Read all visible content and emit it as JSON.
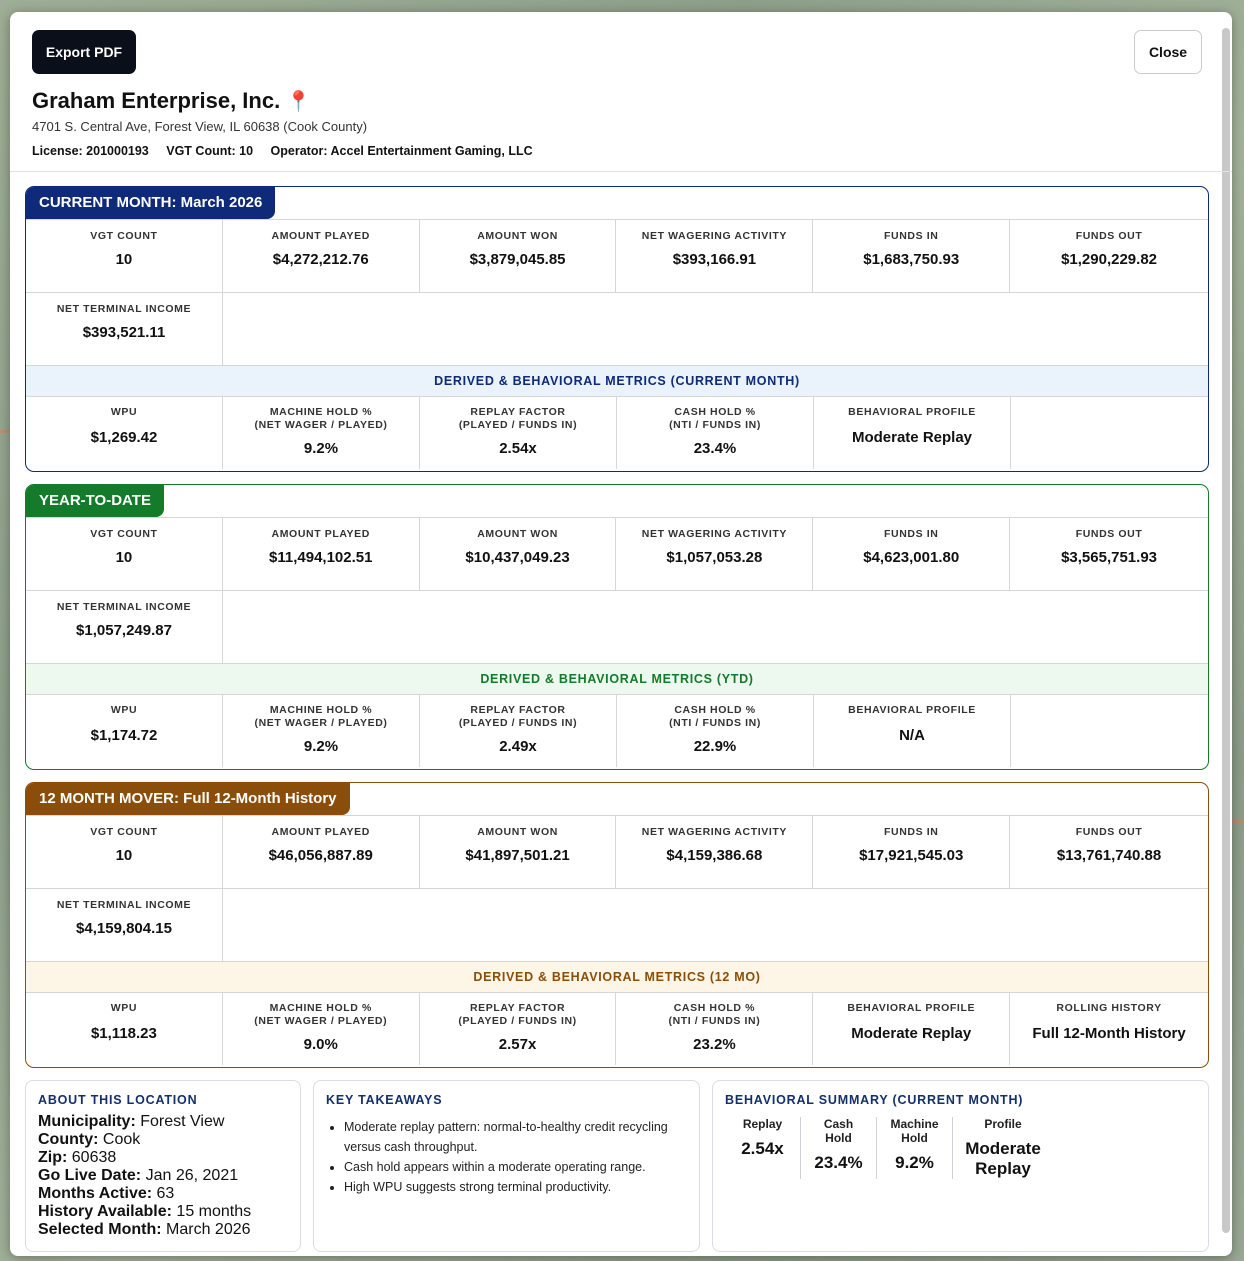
{
  "header": {
    "export_label": "Export PDF",
    "close_label": "Close",
    "title": "Graham Enterprise, Inc.",
    "pin_glyph": "📍",
    "address": "4701 S. Central Ave, Forest View, IL 60638 (Cook County)",
    "license": "License: 201000193",
    "vgt_count": "VGT Count: 10",
    "operator": "Operator: Accel Entertainment Gaming, LLC"
  },
  "colors": {
    "current": "#0e2a78",
    "ytd": "#137b2a",
    "mover": "#8a4e0a",
    "current_sub_bg": "#eaf3fc",
    "ytd_sub_bg": "#edf8ee",
    "mover_sub_bg": "#fdf6e6"
  },
  "current": {
    "tag": "CURRENT MONTH: March 2026",
    "labels": [
      "VGT COUNT",
      "AMOUNT PLAYED",
      "AMOUNT WON",
      "NET WAGERING ACTIVITY",
      "FUNDS IN",
      "FUNDS OUT"
    ],
    "values": [
      "10",
      "$4,272,212.76",
      "$3,879,045.85",
      "$393,166.91",
      "$1,683,750.93",
      "$1,290,229.82"
    ],
    "nti_label": "NET TERMINAL INCOME",
    "nti_value": "$393,521.11",
    "sub": "DERIVED & BEHAVIORAL METRICS (CURRENT MONTH)",
    "derived": [
      {
        "l1": "WPU",
        "l2": "",
        "v": "$1,269.42"
      },
      {
        "l1": "MACHINE HOLD %",
        "l2": "(NET WAGER / PLAYED)",
        "v": "9.2%"
      },
      {
        "l1": "REPLAY FACTOR",
        "l2": "(PLAYED / FUNDS IN)",
        "v": "2.54x"
      },
      {
        "l1": "CASH HOLD %",
        "l2": "(NTI / FUNDS IN)",
        "v": "23.4%"
      },
      {
        "l1": "BEHAVIORAL PROFILE",
        "l2": "",
        "v": "Moderate Replay"
      }
    ]
  },
  "ytd": {
    "tag": "YEAR-TO-DATE",
    "labels": [
      "VGT COUNT",
      "AMOUNT PLAYED",
      "AMOUNT WON",
      "NET WAGERING ACTIVITY",
      "FUNDS IN",
      "FUNDS OUT"
    ],
    "values": [
      "10",
      "$11,494,102.51",
      "$10,437,049.23",
      "$1,057,053.28",
      "$4,623,001.80",
      "$3,565,751.93"
    ],
    "nti_label": "NET TERMINAL INCOME",
    "nti_value": "$1,057,249.87",
    "sub": "DERIVED & BEHAVIORAL METRICS (YTD)",
    "derived": [
      {
        "l1": "WPU",
        "l2": "",
        "v": "$1,174.72"
      },
      {
        "l1": "MACHINE HOLD %",
        "l2": "(NET WAGER / PLAYED)",
        "v": "9.2%"
      },
      {
        "l1": "REPLAY FACTOR",
        "l2": "(PLAYED / FUNDS IN)",
        "v": "2.49x"
      },
      {
        "l1": "CASH HOLD %",
        "l2": "(NTI / FUNDS IN)",
        "v": "22.9%"
      },
      {
        "l1": "BEHAVIORAL PROFILE",
        "l2": "",
        "v": "N/A"
      }
    ]
  },
  "mover": {
    "tag": "12 MONTH MOVER: Full 12-Month History",
    "labels": [
      "VGT COUNT",
      "AMOUNT PLAYED",
      "AMOUNT WON",
      "NET WAGERING ACTIVITY",
      "FUNDS IN",
      "FUNDS OUT"
    ],
    "values": [
      "10",
      "$46,056,887.89",
      "$41,897,501.21",
      "$4,159,386.68",
      "$17,921,545.03",
      "$13,761,740.88"
    ],
    "nti_label": "NET TERMINAL INCOME",
    "nti_value": "$4,159,804.15",
    "sub": "DERIVED & BEHAVIORAL METRICS (12 MO)",
    "derived": [
      {
        "l1": "WPU",
        "l2": "",
        "v": "$1,118.23"
      },
      {
        "l1": "MACHINE HOLD %",
        "l2": "(NET WAGER / PLAYED)",
        "v": "9.0%"
      },
      {
        "l1": "REPLAY FACTOR",
        "l2": "(PLAYED / FUNDS IN)",
        "v": "2.57x"
      },
      {
        "l1": "CASH HOLD %",
        "l2": "(NTI / FUNDS IN)",
        "v": "23.2%"
      },
      {
        "l1": "BEHAVIORAL PROFILE",
        "l2": "",
        "v": "Moderate Replay"
      },
      {
        "l1": "ROLLING HISTORY",
        "l2": "",
        "v": "Full 12-Month History"
      }
    ]
  },
  "about": {
    "title": "ABOUT THIS LOCATION",
    "rows": [
      {
        "k": "Municipality:",
        "v": "Forest View"
      },
      {
        "k": "County:",
        "v": "Cook"
      },
      {
        "k": "Zip:",
        "v": "60638"
      },
      {
        "k": "Go Live Date:",
        "v": "Jan 26, 2021"
      },
      {
        "k": "Months Active:",
        "v": "63"
      },
      {
        "k": "History Available:",
        "v": "15 months"
      },
      {
        "k": "Selected Month:",
        "v": "March 2026"
      }
    ]
  },
  "takeaways": {
    "title": "KEY TAKEAWAYS",
    "items": [
      "Moderate replay pattern: normal-to-healthy credit recycling versus cash throughput.",
      "Cash hold appears within a moderate operating range.",
      "High WPU suggests strong terminal productivity."
    ]
  },
  "behavioral": {
    "title": "BEHAVIORAL SUMMARY (CURRENT MONTH)",
    "cols": [
      {
        "l": "Replay",
        "v": "2.54x"
      },
      {
        "l": "Cash Hold",
        "v": "23.4%"
      },
      {
        "l": "Machine Hold",
        "v": "9.2%"
      },
      {
        "l": "Profile",
        "v": "Moderate Replay"
      }
    ]
  }
}
